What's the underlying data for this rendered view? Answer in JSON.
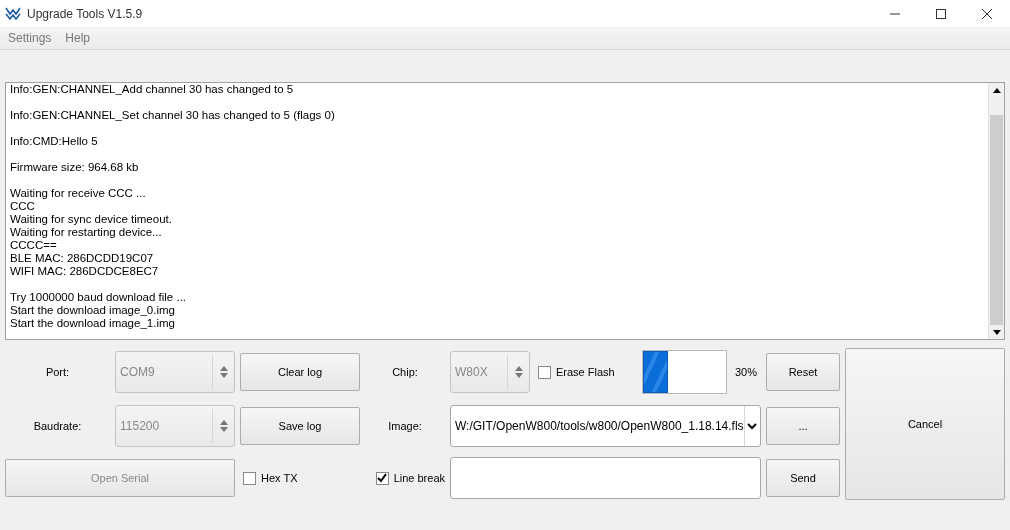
{
  "window": {
    "title": "Upgrade Tools V1.5.9"
  },
  "menu": [
    {
      "label": "Settings"
    },
    {
      "label": "Help"
    }
  ],
  "log": {
    "blocks": [
      [
        "Info:GEN:CHANNEL_Add channel 30 has changed to 5"
      ],
      [
        "Info:GEN:CHANNEL_Set channel 30 has changed to 5 (flags 0)"
      ],
      [
        "Info:CMD:Hello 5"
      ],
      [
        "Firmware size: 964.68 kb"
      ],
      [
        "Waiting for receive CCC ...",
        "CCC",
        "Waiting for sync device timeout.",
        "Waiting for restarting device...",
        "CCCC==",
        "BLE  MAC: 286DCDD19C07",
        "WIFI MAC: 286DCDCE8EC7"
      ],
      [
        "Try 1000000 baud download file ...",
        "Start the download image_0.img",
        "Start the download image_1.img"
      ]
    ]
  },
  "port": {
    "label": "Port:",
    "value": "COM9",
    "disabled": true
  },
  "baudrate": {
    "label": "Baudrate:",
    "value": "115200",
    "disabled": true
  },
  "clear_log": {
    "label": "Clear log"
  },
  "save_log": {
    "label": "Save log"
  },
  "open_serial": {
    "label": "Open Serial",
    "disabled": true
  },
  "hex_tx": {
    "label": "Hex TX",
    "checked": false
  },
  "line_break": {
    "label": "Line break",
    "checked": true
  },
  "chip": {
    "label": "Chip:",
    "value": "W80X",
    "disabled": true
  },
  "erase_flash": {
    "label": "Erase Flash",
    "checked": false
  },
  "progress": {
    "level": 0.3,
    "reading": "30%"
  },
  "reset": {
    "label": "Reset"
  },
  "image": {
    "label": "Image:",
    "value": "W:/GIT/OpenW800/tools/w800/OpenW800_1.18.14.fls"
  },
  "browse": {
    "label": "..."
  },
  "send": {
    "label": "Send"
  },
  "cancel": {
    "label": "Cancel"
  }
}
